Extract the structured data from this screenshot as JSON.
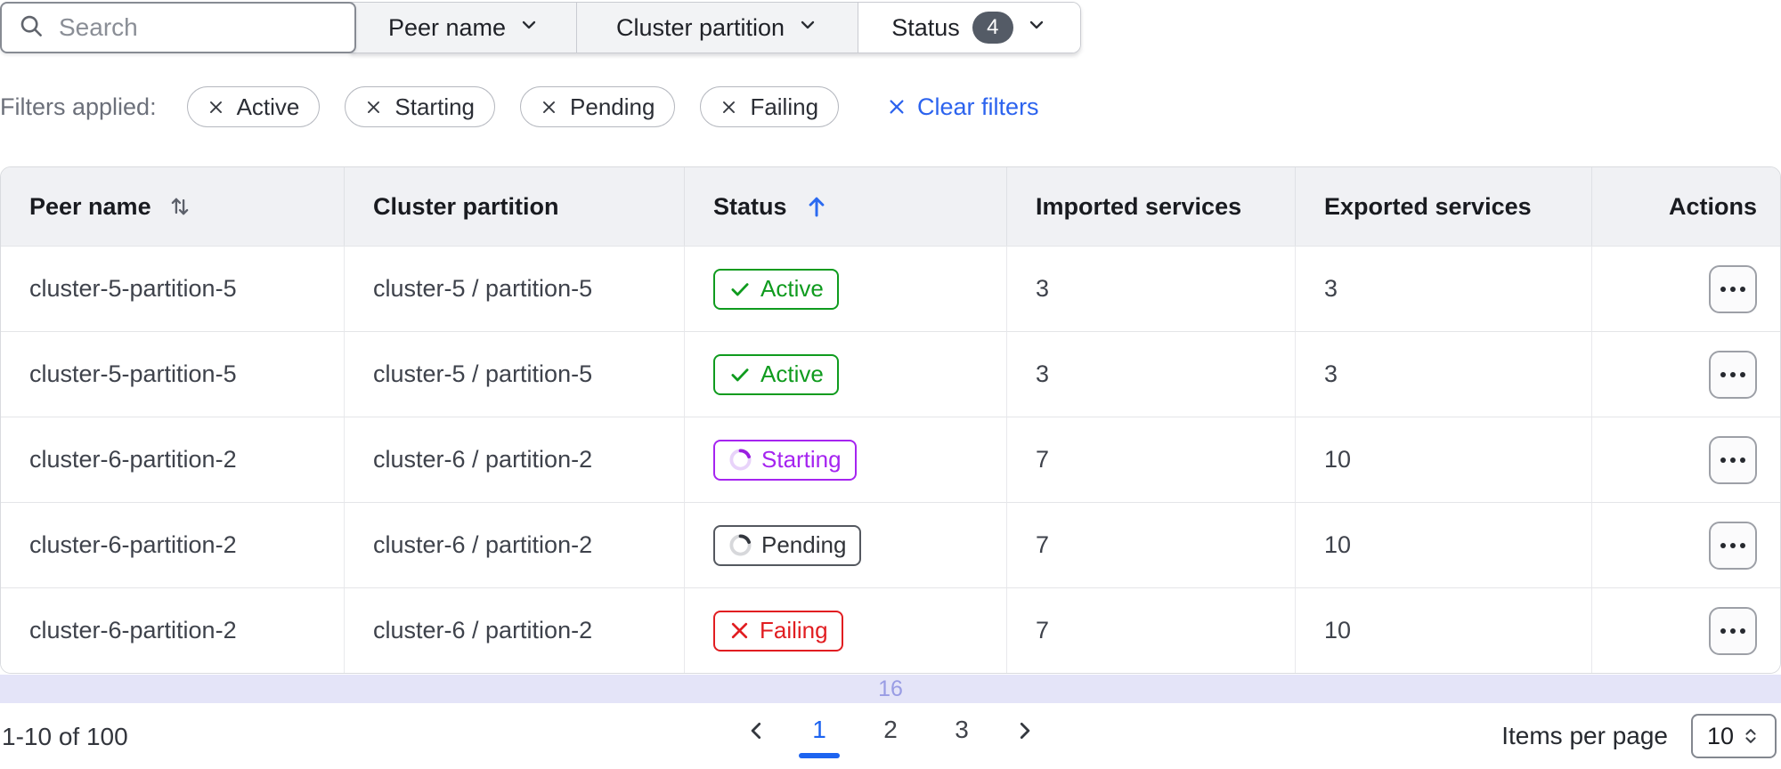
{
  "toolbar": {
    "search": {
      "placeholder": "Search"
    },
    "dropdowns": [
      {
        "label": "Peer name"
      },
      {
        "label": "Cluster partition"
      },
      {
        "label": "Status",
        "badge": "4"
      }
    ]
  },
  "filters": {
    "label": "Filters applied:",
    "chips": [
      "Active",
      "Starting",
      "Pending",
      "Failing"
    ],
    "clear_label": "Clear filters"
  },
  "table": {
    "columns": [
      {
        "label": "Peer name",
        "sort": "sortable"
      },
      {
        "label": "Cluster partition",
        "sort": "none"
      },
      {
        "label": "Status",
        "sort": "ascending"
      },
      {
        "label": "Imported services",
        "sort": "none"
      },
      {
        "label": "Exported services",
        "sort": "none"
      },
      {
        "label": "Actions",
        "sort": "none"
      }
    ],
    "rows": [
      {
        "peer": "cluster-5-partition-5",
        "partition": "cluster-5 / partition-5",
        "status": "Active",
        "status_kind": "active",
        "imported": "3",
        "exported": "3"
      },
      {
        "peer": "cluster-5-partition-5",
        "partition": "cluster-5 / partition-5",
        "status": "Active",
        "status_kind": "active",
        "imported": "3",
        "exported": "3"
      },
      {
        "peer": "cluster-6-partition-2",
        "partition": "cluster-6 / partition-2",
        "status": "Starting",
        "status_kind": "starting",
        "imported": "7",
        "exported": "10"
      },
      {
        "peer": "cluster-6-partition-2",
        "partition": "cluster-6 / partition-2",
        "status": "Pending",
        "status_kind": "pending",
        "imported": "7",
        "exported": "10"
      },
      {
        "peer": "cluster-6-partition-2",
        "partition": "cluster-6 / partition-2",
        "status": "Failing",
        "status_kind": "failing",
        "imported": "7",
        "exported": "10"
      }
    ]
  },
  "footer_bar": {
    "value": "16"
  },
  "pagination": {
    "range": "1-10 of 100",
    "pages": [
      "1",
      "2",
      "3"
    ],
    "current_page": "1",
    "items_per_page_label": "Items per page",
    "items_per_page_value": "10"
  },
  "colors": {
    "accent_blue": "#1d64f0",
    "success_green": "#0f9b1e",
    "starting_purple": "#a524f0",
    "pending_gray": "#54585f",
    "failing_red": "#e11d21",
    "strip_lavender": "#e4e4f8",
    "header_bg": "#f0f1f4",
    "badge_count_bg": "#545b66"
  }
}
